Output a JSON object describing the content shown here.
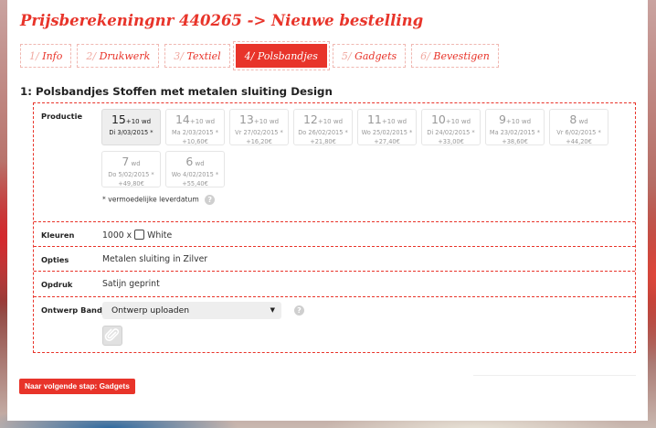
{
  "page": {
    "title": "Prijsberekeningnr 440265 -> Nieuwe bestelling",
    "section_title": "1: Polsbandjes Stoffen met metalen sluiting Design"
  },
  "steps": [
    {
      "num": "1/",
      "label": "Info",
      "active": false
    },
    {
      "num": "2/",
      "label": "Drukwerk",
      "active": false
    },
    {
      "num": "3/",
      "label": "Textiel",
      "active": false
    },
    {
      "num": "4/",
      "label": "Polsbandjes",
      "active": true
    },
    {
      "num": "5/",
      "label": "Gadgets",
      "active": false
    },
    {
      "num": "6/",
      "label": "Bevestigen",
      "active": false
    }
  ],
  "productie": {
    "label": "Productie",
    "options": [
      {
        "days": "15",
        "suffix": "+10 wd",
        "date": "Di 3/03/2015 *",
        "price": "",
        "selected": true
      },
      {
        "days": "14",
        "suffix": "+10 wd",
        "date": "Ma 2/03/2015 *",
        "price": "+10,60€",
        "selected": false
      },
      {
        "days": "13",
        "suffix": "+10 wd",
        "date": "Vr 27/02/2015 *",
        "price": "+16,20€",
        "selected": false
      },
      {
        "days": "12",
        "suffix": "+10 wd",
        "date": "Do 26/02/2015 *",
        "price": "+21,80€",
        "selected": false
      },
      {
        "days": "11",
        "suffix": "+10 wd",
        "date": "Wo 25/02/2015 *",
        "price": "+27,40€",
        "selected": false
      },
      {
        "days": "10",
        "suffix": "+10 wd",
        "date": "Di 24/02/2015 *",
        "price": "+33,00€",
        "selected": false
      },
      {
        "days": "9",
        "suffix": "+10 wd",
        "date": "Ma 23/02/2015 *",
        "price": "+38,60€",
        "selected": false
      },
      {
        "days": "8",
        "suffix": " wd",
        "date": "Vr 6/02/2015 *",
        "price": "+44,20€",
        "selected": false
      },
      {
        "days": "7",
        "suffix": " wd",
        "date": "Do 5/02/2015 *",
        "price": "+49,80€",
        "selected": false
      },
      {
        "days": "6",
        "suffix": " wd",
        "date": "Wo 4/02/2015 *",
        "price": "+55,40€",
        "selected": false
      }
    ],
    "note": "* vermoedelijke leverdatum"
  },
  "kleuren": {
    "label": "Kleuren",
    "quantity": "1000 x",
    "color_name": "White",
    "swatch_color": "#ffffff"
  },
  "opties": {
    "label": "Opties",
    "value": "Metalen sluiting in Zilver"
  },
  "opdruk": {
    "label": "Opdruk",
    "value": "Satijn geprint"
  },
  "ontwerp": {
    "label": "Ontwerp Bandje",
    "select_value": "Ontwerp uploaden"
  },
  "icons": {
    "help": "?",
    "caret": "▼",
    "paperclip": "paperclip-icon"
  },
  "next_button": "Naar volgende stap: Gadgets",
  "colors": {
    "accent": "#e8342a",
    "selected_bg": "#eeeeee"
  }
}
